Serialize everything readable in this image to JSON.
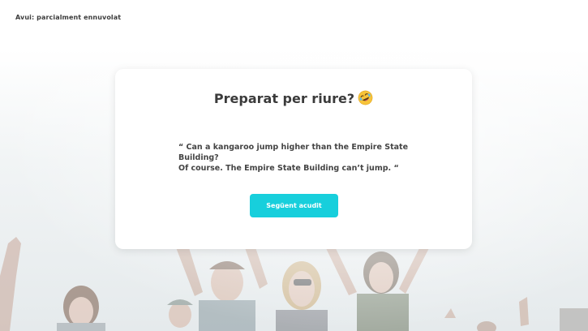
{
  "header": {
    "weather_text": "Avui: parcialment ennuvolat"
  },
  "card": {
    "title": "Preparat per riure?",
    "emoji": "rolling-on-floor-laughing-emoji",
    "joke_line1": "“ Can a kangaroo jump higher than the Empire State Building?",
    "joke_line2": "Of course. The Empire State Building can’t jump. “",
    "next_button_label": "Següent acudit",
    "accent_color": "#17cfdc"
  }
}
